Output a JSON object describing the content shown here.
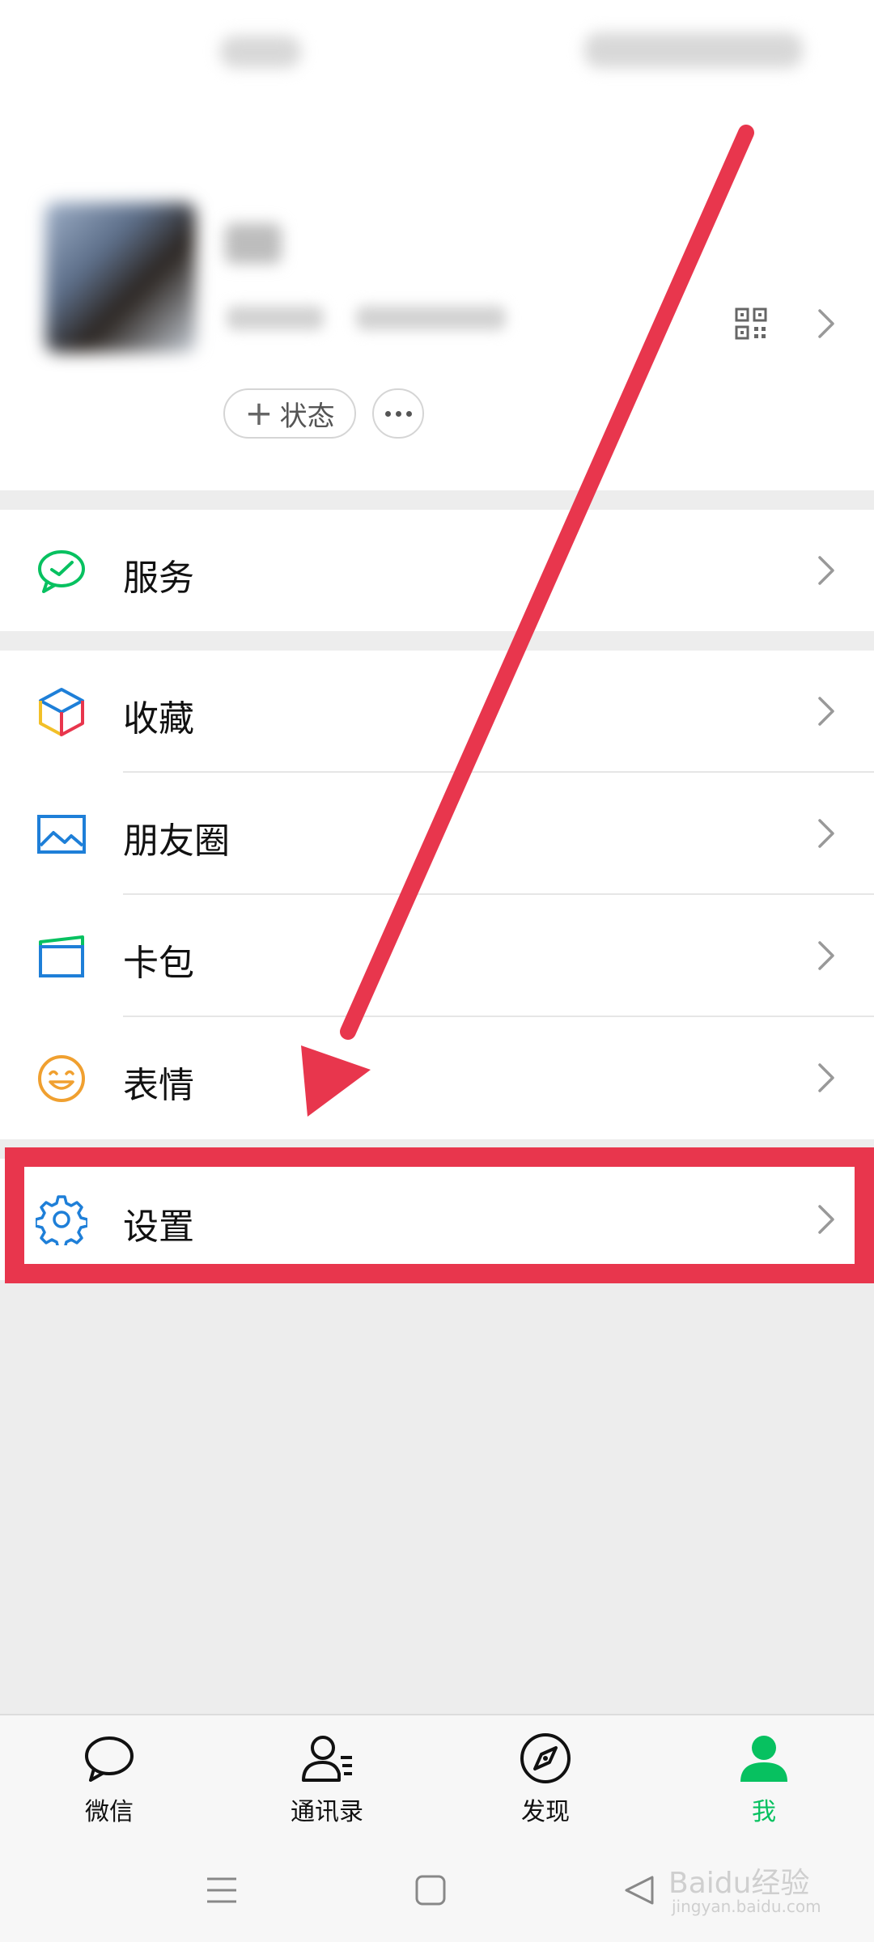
{
  "profile": {
    "status_label": "状态",
    "status_plus": "+"
  },
  "menu": {
    "service": "服务",
    "favorites": "收藏",
    "moments": "朋友圈",
    "cards": "卡包",
    "stickers": "表情",
    "settings": "设置"
  },
  "tabs": [
    {
      "label": "微信",
      "icon": "chat-bubble-icon"
    },
    {
      "label": "通讯录",
      "icon": "contacts-icon"
    },
    {
      "label": "发现",
      "icon": "compass-icon"
    },
    {
      "label": "我",
      "icon": "person-icon"
    }
  ],
  "active_tab": "我",
  "colors": {
    "accent_green": "#07c160",
    "highlight_red": "#e8364d",
    "icon_blue": "#1e7fd8",
    "sticker_orange": "#f0a030"
  },
  "watermark": {
    "text": "Baidu经验",
    "url_text": "jingyan.baidu.com"
  }
}
